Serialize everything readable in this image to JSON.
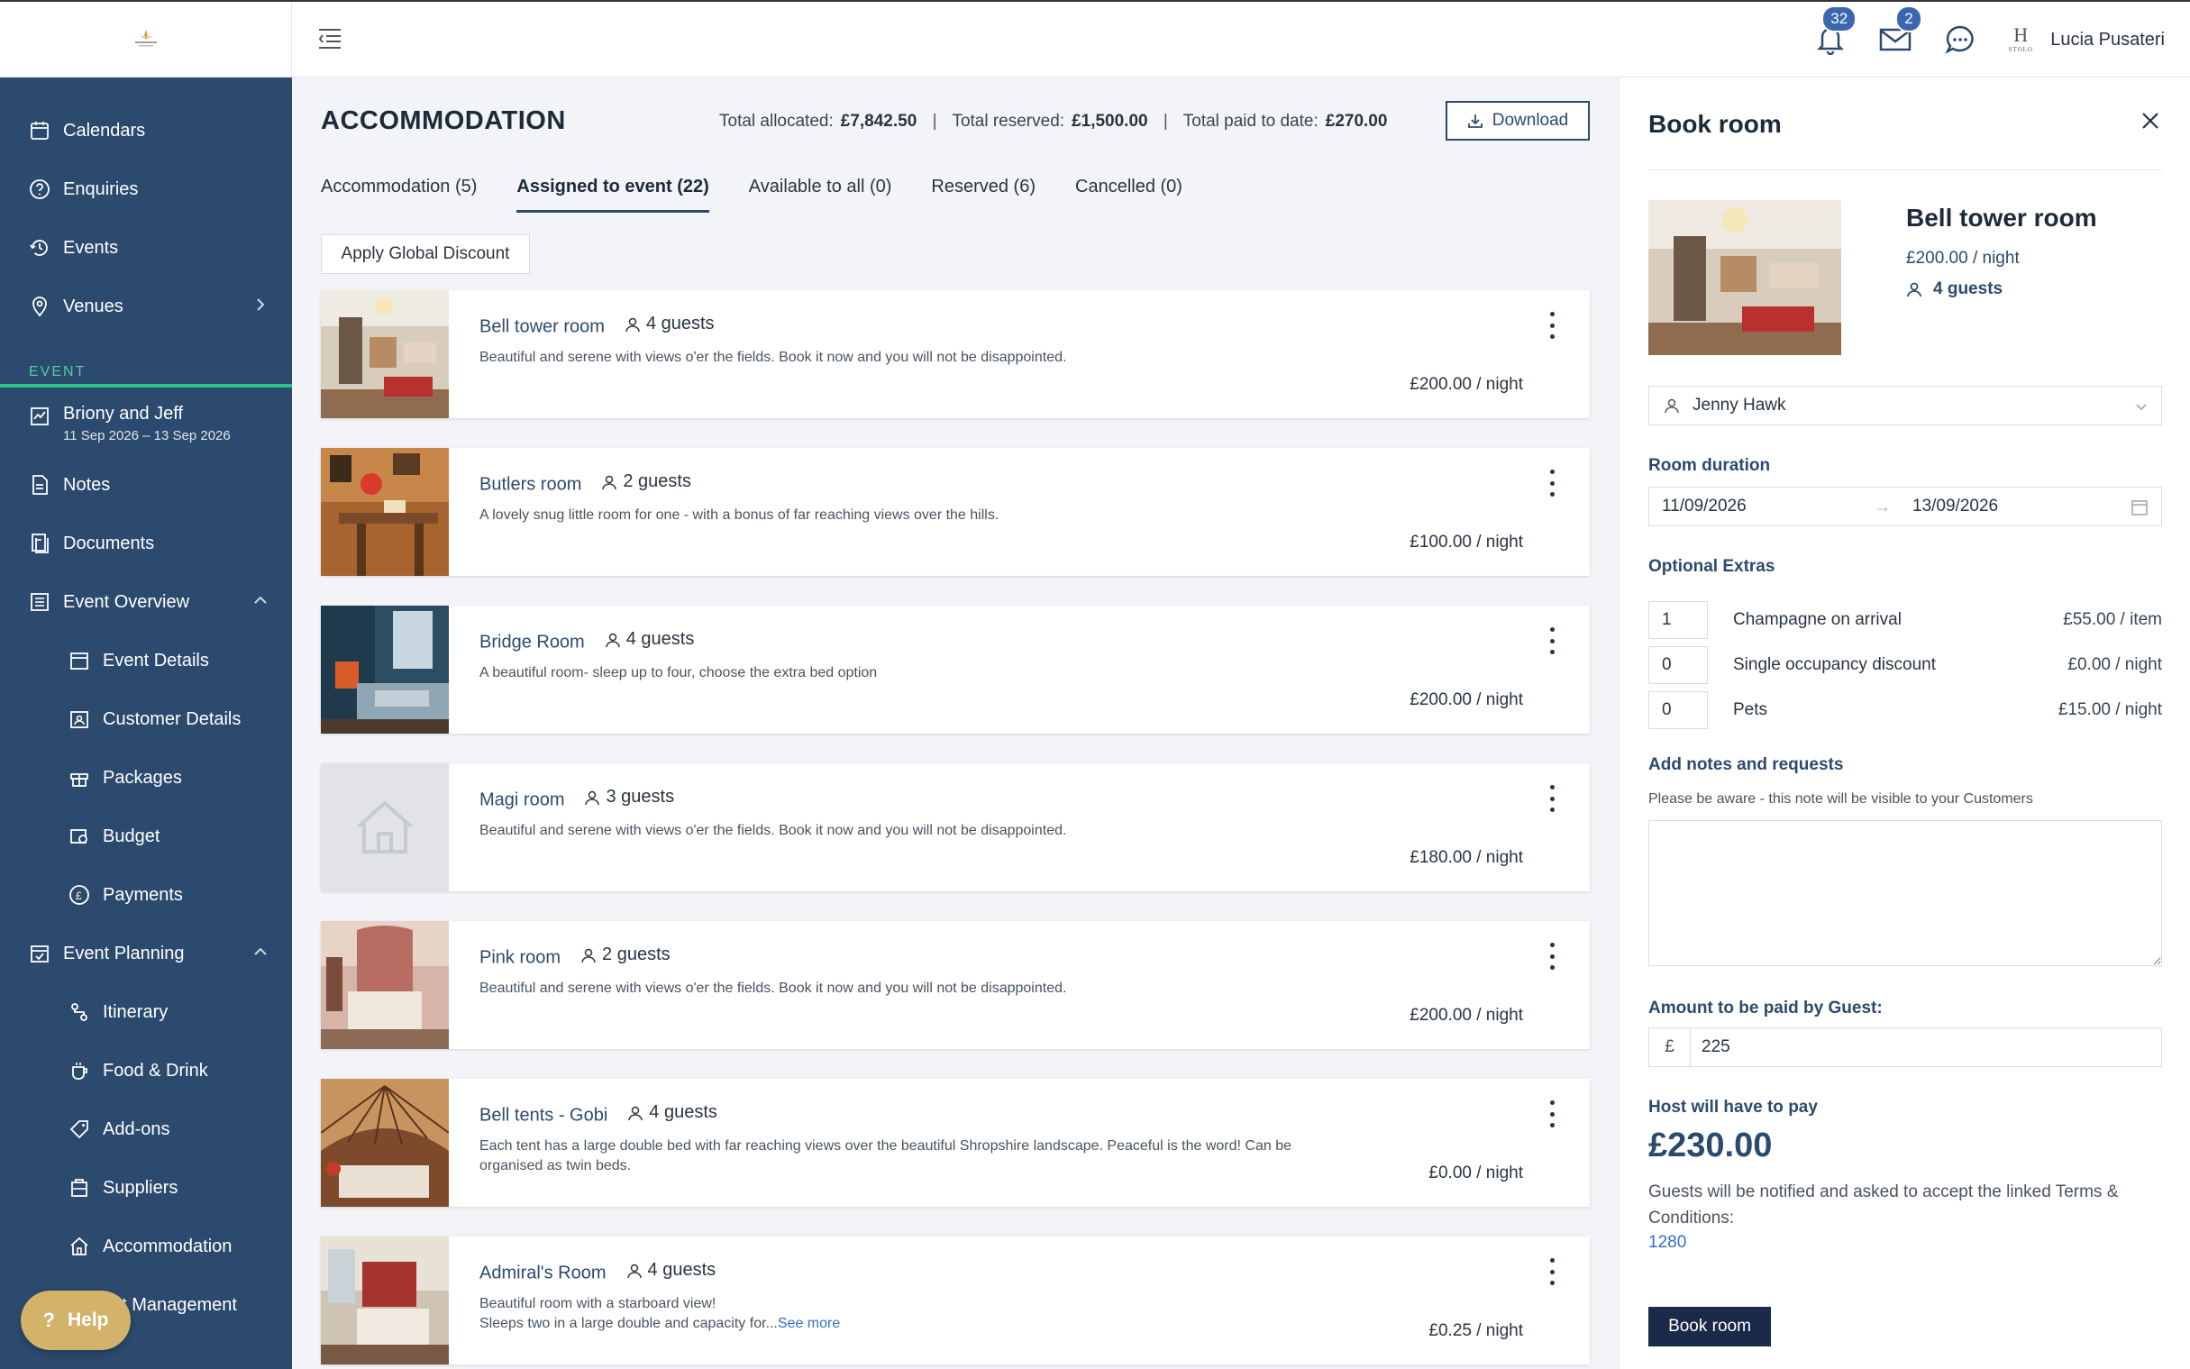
{
  "topbar": {
    "notifications_count": "32",
    "messages_count": "2",
    "user_name": "Lucia Pusateri",
    "user_logo_letter": "H",
    "user_logo_text": "STOLO"
  },
  "sidebar": {
    "items": [
      {
        "label": "Calendars",
        "icon": "calendar-icon"
      },
      {
        "label": "Enquiries",
        "icon": "question-circle-icon"
      },
      {
        "label": "Events",
        "icon": "history-icon"
      },
      {
        "label": "Venues",
        "icon": "location-pin-icon"
      }
    ],
    "section_label": "EVENT",
    "event": {
      "name": "Briony and Jeff",
      "dates": "11 Sep 2026 – 13 Sep 2026"
    },
    "event_items": [
      {
        "label": "Notes",
        "icon": "notes-icon"
      },
      {
        "label": "Documents",
        "icon": "documents-icon"
      },
      {
        "label": "Event Overview",
        "icon": "list-icon"
      },
      {
        "label": "Event Details",
        "icon": "calendar-icon"
      },
      {
        "label": "Customer Details",
        "icon": "contact-card-icon"
      },
      {
        "label": "Packages",
        "icon": "gift-icon"
      },
      {
        "label": "Budget",
        "icon": "budget-icon"
      },
      {
        "label": "Payments",
        "icon": "pound-circle-icon"
      },
      {
        "label": "Event Planning",
        "icon": "calendar-check-icon"
      },
      {
        "label": "Itinerary",
        "icon": "route-icon"
      },
      {
        "label": "Food & Drink",
        "icon": "cup-icon"
      },
      {
        "label": "Add-ons",
        "icon": "tag-icon"
      },
      {
        "label": "Suppliers",
        "icon": "box-icon"
      },
      {
        "label": "Accommodation",
        "icon": "home-icon"
      },
      {
        "label": "est Management",
        "icon": "users-icon"
      }
    ],
    "help_label": "Help"
  },
  "main": {
    "title": "ACCOMMODATION",
    "totals": {
      "allocated_label": "Total allocated:",
      "allocated_value": "£7,842.50",
      "reserved_label": "Total reserved:",
      "reserved_value": "£1,500.00",
      "paid_label": "Total paid to date:",
      "paid_value": "£270.00",
      "separator": "|"
    },
    "download_label": "Download",
    "tabs": [
      {
        "label": "Accommodation  (5)"
      },
      {
        "label": "Assigned to event  (22)"
      },
      {
        "label": "Available to all  (0)"
      },
      {
        "label": "Reserved  (6)"
      },
      {
        "label": "Cancelled  (0)"
      }
    ],
    "active_tab": 1,
    "discount_label": "Apply Global Discount",
    "rooms": [
      {
        "name": "Bell tower room",
        "guests": "4 guests",
        "desc": "Beautiful and serene with views o'er the fields. Book it now and you will not be disappointed.",
        "price": "£200.00 / night",
        "image": "bedroom-photo"
      },
      {
        "name": "Butlers room",
        "guests": "2 guests",
        "desc": "A lovely snug little room for one - with a bonus of far reaching views over the hills.",
        "price": "£100.00 / night",
        "image": "desk-photo"
      },
      {
        "name": "Bridge Room",
        "guests": "4 guests",
        "desc": "A beautiful room- sleep up to four, choose the extra bed option",
        "price": "£200.00 / night",
        "image": "blue-room-photo"
      },
      {
        "name": "Magi room",
        "guests": "3 guests",
        "desc": "Beautiful and serene with views o'er the fields. Book it now and you will not be disappointed.",
        "price": "£180.00 / night",
        "image": "placeholder-house"
      },
      {
        "name": "Pink room",
        "guests": "2 guests",
        "desc": "Beautiful and serene with views o'er the fields. Book it now and you will not be disappointed.",
        "price": "£200.00 / night",
        "image": "pink-room-photo"
      },
      {
        "name": "Bell tents - Gobi",
        "guests": "4 guests",
        "desc": "Each tent has a large double bed with far reaching views over the beautiful Shropshire landscape. Peaceful is the word! Can be organised as twin beds.",
        "price": "£0.00 / night",
        "image": "yurt-photo"
      },
      {
        "name": "Admiral's Room",
        "guests": "4 guests",
        "desc": "Beautiful room with a starboard view!",
        "desc2": "Sleeps two in a large double and capacity for...",
        "see_more": "See more",
        "price": "£0.25 / night",
        "image": "admiral-room-photo"
      }
    ]
  },
  "panel": {
    "title": "Book room",
    "room_name": "Bell tower room",
    "room_price": "£200.00 / night",
    "room_guests": "4 guests",
    "guest_name": "Jenny Hawk",
    "duration_label": "Room duration",
    "date_from": "11/09/2026",
    "date_to": "13/09/2026",
    "extras_label": "Optional Extras",
    "extras": [
      {
        "qty": "1",
        "name": "Champagne on arrival",
        "price": "£55.00 / item"
      },
      {
        "qty": "0",
        "name": "Single occupancy discount",
        "price": "£0.00 / night"
      },
      {
        "qty": "0",
        "name": "Pets",
        "price": "£15.00 / night"
      }
    ],
    "notes_label": "Add notes and requests",
    "notes_hint": "Please be aware - this note will be visible to your Customers",
    "notes_value": "",
    "amount_label": "Amount to be paid by Guest:",
    "currency": "£",
    "amount_value": "225",
    "host_label": "Host will have to pay",
    "host_amount": "£230.00",
    "notice": "Guests will be notified and asked to accept the linked Terms & Conditions:",
    "link_text": "1280",
    "book_label": "Book room"
  },
  "colors": {
    "sidebar_bg": "#2c4a6e",
    "accent_green": "#2ec28b",
    "badge_blue": "#3b67b1",
    "help_gold": "#d3b26a",
    "book_btn": "#1c2a4a"
  }
}
